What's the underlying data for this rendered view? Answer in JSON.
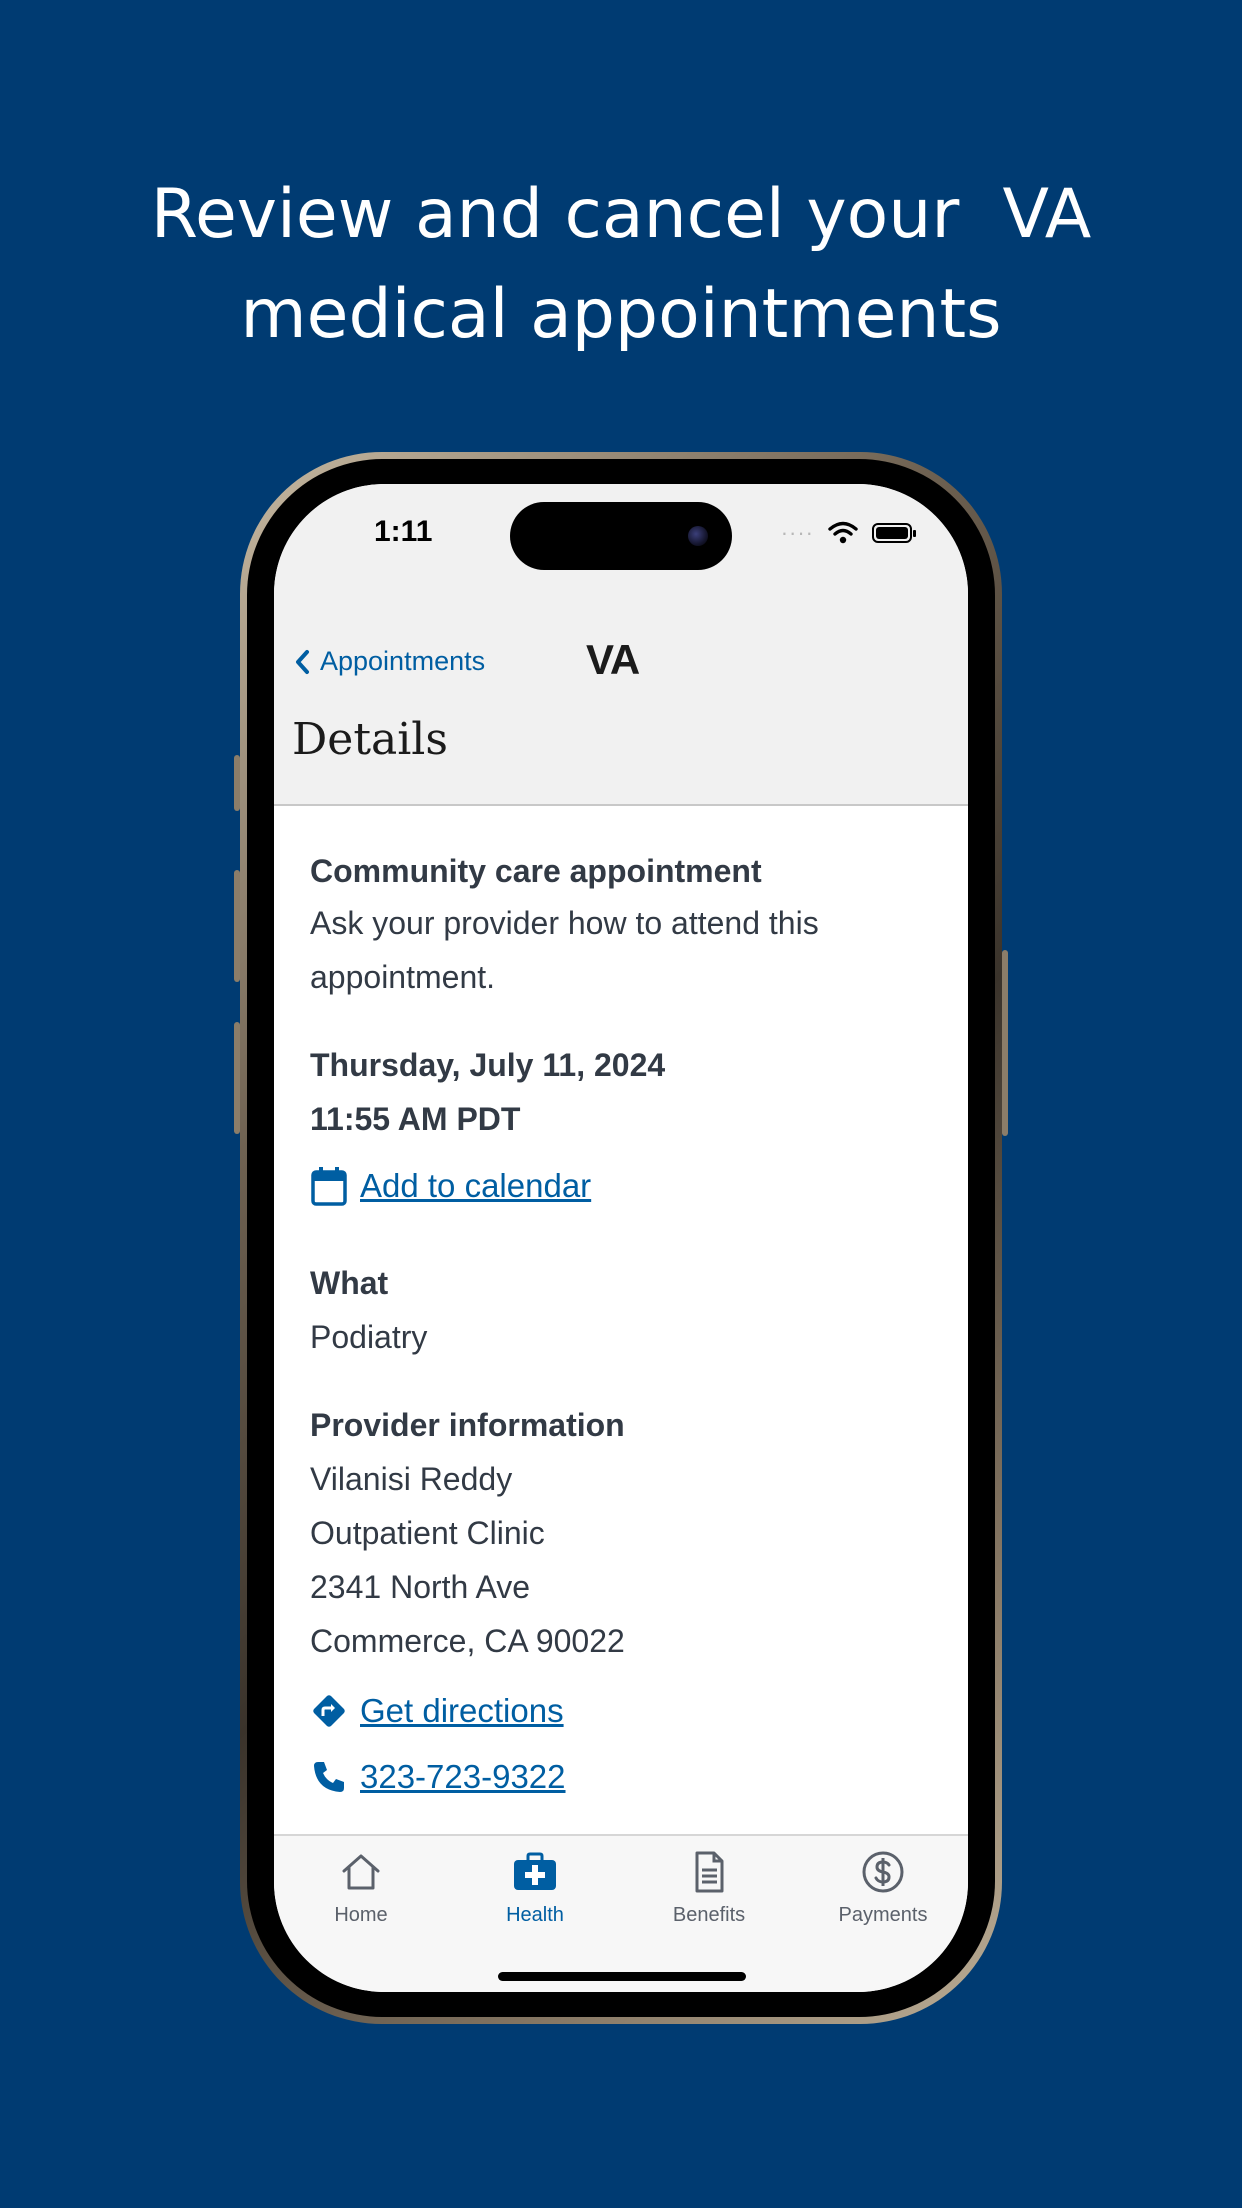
{
  "headline": {
    "line1": "Review and cancel your  VA",
    "line2": "medical appointments"
  },
  "status_bar": {
    "time": "1:11",
    "signal_dots": "····"
  },
  "nav": {
    "back_label": "Appointments",
    "logo": "VA",
    "page_title": "Details"
  },
  "appointment": {
    "type_heading": "Community care appointment",
    "type_note_line1": "Ask your provider how to attend this",
    "type_note_line2": "appointment.",
    "date": "Thursday, July 11, 2024",
    "time": "11:55 AM PDT",
    "add_to_calendar": "Add to calendar",
    "what_heading": "What",
    "what_value": "Podiatry",
    "provider_heading": "Provider information",
    "provider_name": "Vilanisi Reddy",
    "provider_facility": "Outpatient Clinic",
    "provider_street": "2341 North Ave",
    "provider_city": "Commerce, CA 90022",
    "get_directions": "Get directions",
    "phone": "323-723-9322"
  },
  "tabs": [
    {
      "label": "Home",
      "icon": "home-icon"
    },
    {
      "label": "Health",
      "icon": "medical-kit-icon",
      "active": true
    },
    {
      "label": "Benefits",
      "icon": "document-icon"
    },
    {
      "label": "Payments",
      "icon": "dollar-circle-icon"
    }
  ],
  "colors": {
    "background": "#003b72",
    "link": "#005ea2",
    "text": "#323a45",
    "header_bg": "#f1f1f1"
  }
}
